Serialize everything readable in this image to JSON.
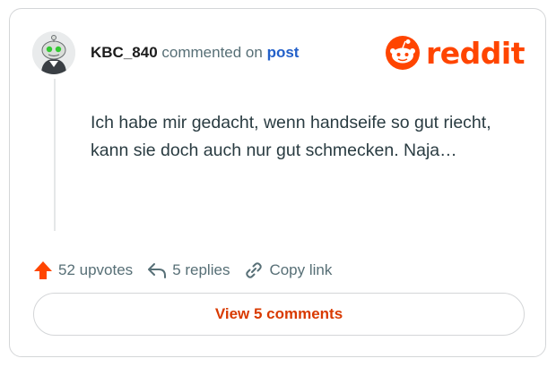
{
  "comment": {
    "username": "KBC_840",
    "action_text": "commented on",
    "target_link": "post",
    "body": "Ich habe mir gedacht, wenn handseife so gut riecht, kann sie doch auch nur gut schmecken. Naja…"
  },
  "brand": {
    "name": "reddit",
    "color": "#ff4500"
  },
  "actions": {
    "upvotes": "52 upvotes",
    "replies": "5 replies",
    "copy_link": "Copy link"
  },
  "view_button": {
    "label": "View 5 comments"
  },
  "icons": {
    "avatar": "snoo-avatar",
    "upvote": "upvote-arrow-icon",
    "reply": "reply-arrow-icon",
    "link": "link-icon",
    "logo": "reddit-snoo-icon"
  }
}
